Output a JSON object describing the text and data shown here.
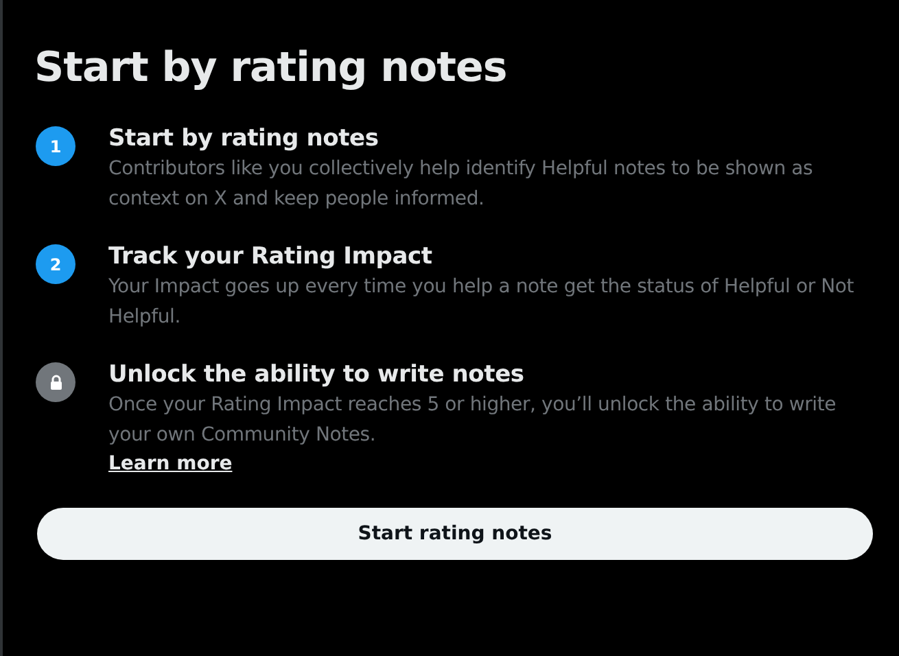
{
  "title": "Start by rating notes",
  "steps": [
    {
      "kind": "number",
      "badge": "1",
      "heading": "Start by rating notes",
      "body": "Contributors like you collectively help identify Helpful notes to be shown as context on X and keep people informed."
    },
    {
      "kind": "number",
      "badge": "2",
      "heading": "Track your Rating Impact",
      "body": "Your Impact goes up every time you help a note get the status of Helpful or Not Helpful."
    },
    {
      "kind": "locked",
      "heading": "Unlock the ability to write notes",
      "body": "Once your Rating Impact reaches 5 or higher, you’ll unlock the ability to write your own Community Notes.",
      "link": "Learn more"
    }
  ],
  "button": "Start rating notes"
}
